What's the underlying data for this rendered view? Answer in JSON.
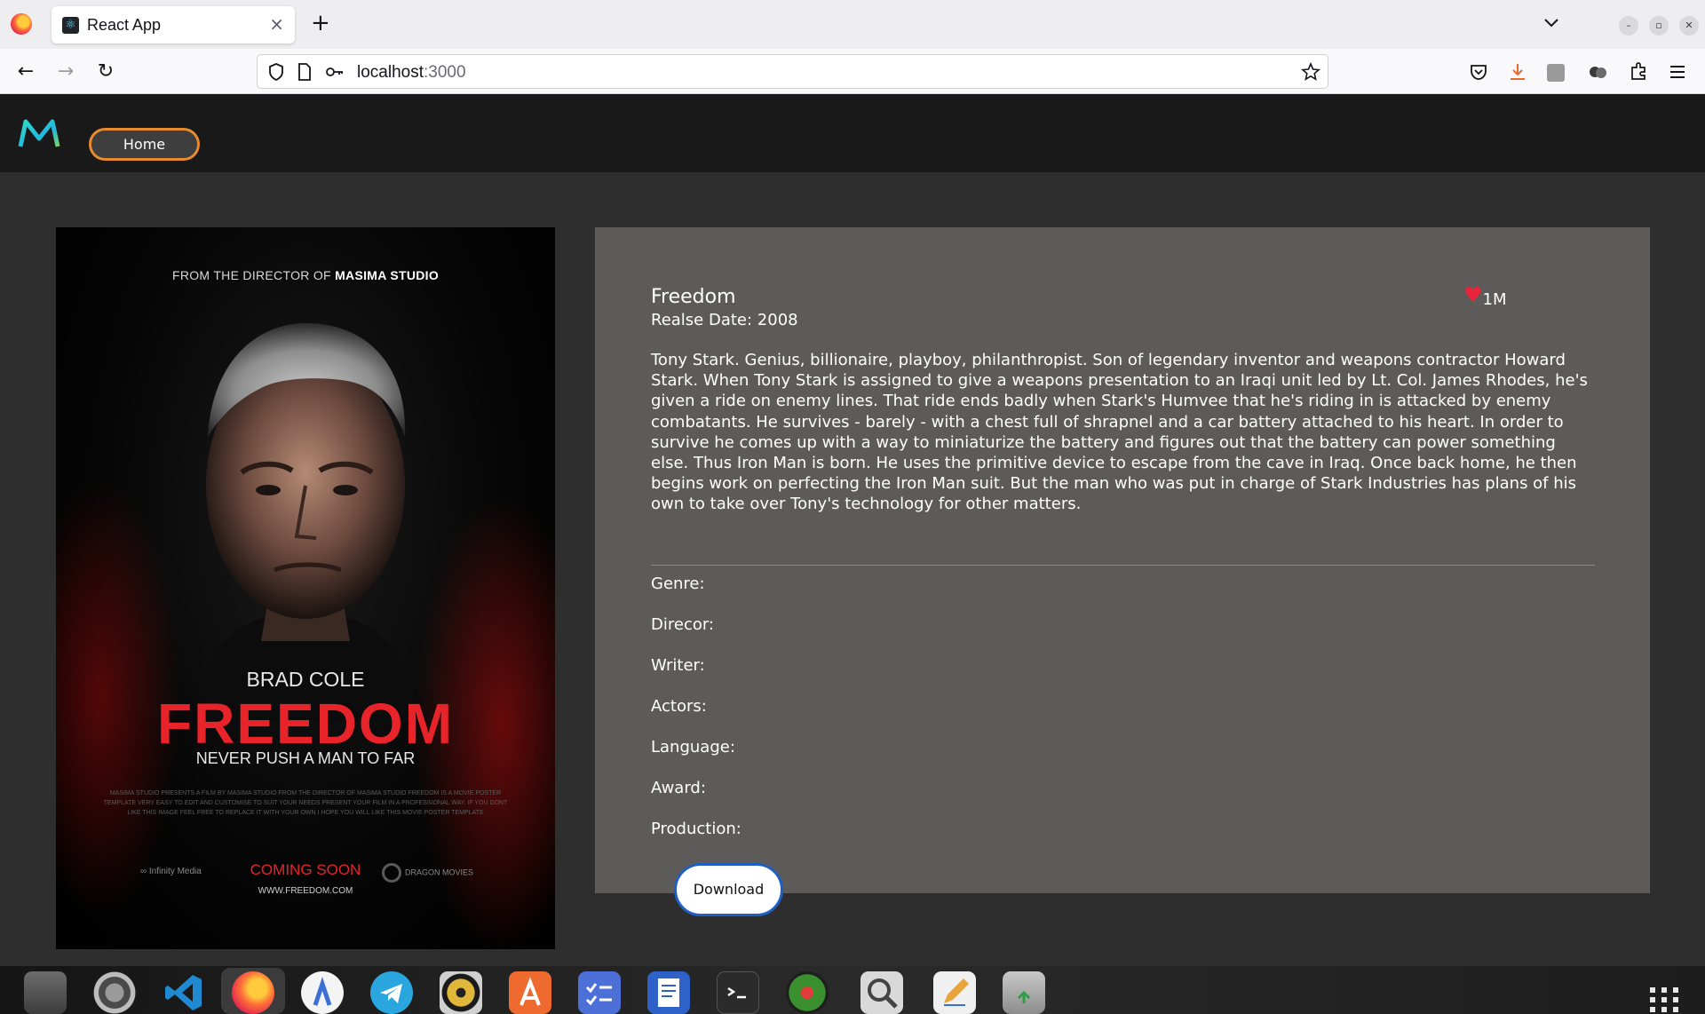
{
  "browser": {
    "tab_title": "React App",
    "tab_close": "×",
    "new_tab": "+",
    "url_host": "localhost",
    "url_port": ":3000"
  },
  "app": {
    "nav_home": "Home",
    "logo_letter": "M"
  },
  "poster": {
    "top_line_prefix": "FROM THE DIRECTOR OF ",
    "top_line_studio": "MASIMA STUDIO",
    "actor": "BRAD COLE",
    "title": "FREEDOM",
    "tagline": "NEVER PUSH A MAN TO FAR",
    "credits": "MASIMA STUDIO PRESENTS A FILM BY MASIMA STUDIO FROM THE DIRECTOR OF MASIMA STUDIO FREEDOM IS A MOVIE POSTER TEMPLATE VERY EASY TO EDIT AND CUSTOMISE TO SUIT YOUR NEEDS PRESENT YOUR FILM IN A PROFESSIONAL WAY. IF YOU DONT LIKE THIS IMAGE FEEL FREE TO REPLACE IT WITH YOUR OWN I HOPE YOU WILL LIKE THIS MOVIE POSTER TEMPLATE",
    "studio_left": "∞ Infinity Media",
    "coming_soon": "COMING SOON",
    "studio_right": "DRAGON MOVIES",
    "website": "WWW.FREEDOM.COM"
  },
  "movie": {
    "title": "Freedom",
    "likes": "1M",
    "release": "Realse Date: 2008",
    "plot": "Tony Stark. Genius, billionaire, playboy, philanthropist. Son of legendary inventor and weapons contractor Howard Stark. When Tony Stark is assigned to give a weapons presentation to an Iraqi unit led by Lt. Col. James Rhodes, he's given a ride on enemy lines. That ride ends badly when Stark's Humvee that he's riding in is attacked by enemy combatants. He survives - barely - with a chest full of shrapnel and a car battery attached to his heart. In order to survive he comes up with a way to miniaturize the battery and figures out that the battery can power something else. Thus Iron Man is born. He uses the primitive device to escape from the cave in Iraq. Once back home, he then begins work on perfecting the Iron Man suit. But the man who was put in charge of Stark Industries has plans of his own to take over Tony's technology for other matters.",
    "genre_label": "Genre:",
    "director_label": "Direcor:",
    "writer_label": "Writer:",
    "actors_label": "Actors:",
    "language_label": "Language:",
    "award_label": "Award:",
    "production_label": "Production:",
    "download_label": "Download"
  },
  "colors": {
    "accent_orange": "#e88b2e",
    "heart_red": "#e8243b",
    "download_border": "#1f5fc4",
    "poster_red": "#e8242a"
  }
}
